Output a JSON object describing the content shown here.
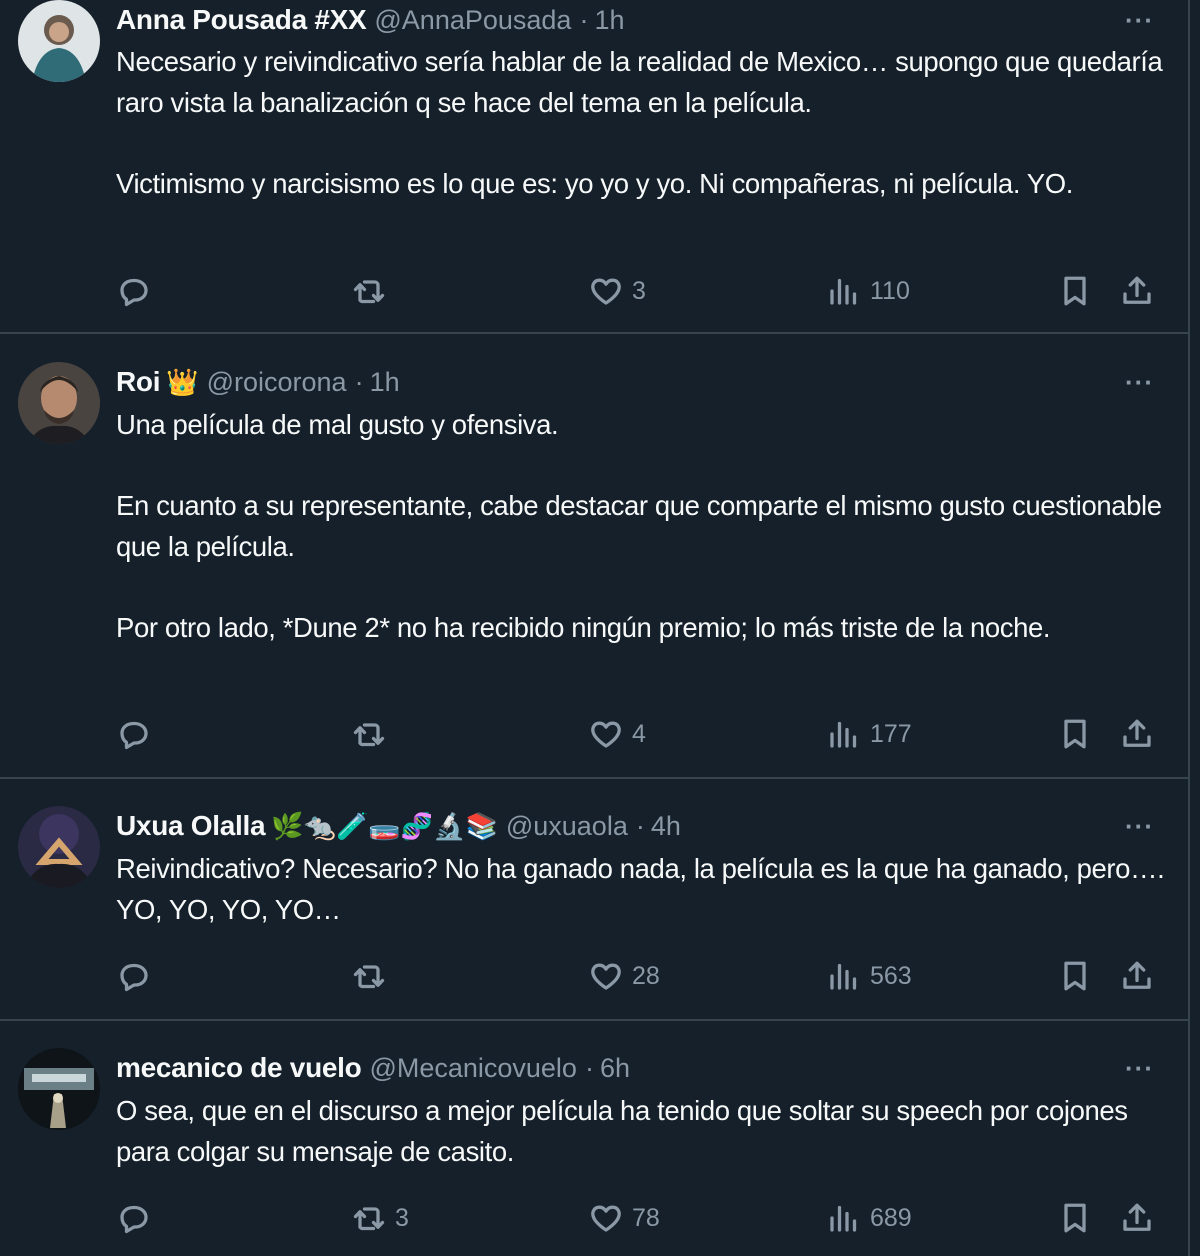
{
  "tweets": [
    {
      "name": "Anna Pousada #XX",
      "emoji": "",
      "handle": "@AnnaPousada",
      "time": "1h",
      "paragraphs": [
        "Necesario y reivindicativo sería hablar de la realidad de Mexico… supongo que quedaría raro vista la banalización q se hace del tema en la película.",
        "Victimismo y narcisismo es lo que es: yo yo y yo. Ni compañeras, ni película. YO."
      ],
      "replies": "",
      "retweets": "",
      "likes": "3",
      "views": "110"
    },
    {
      "name": "Roi",
      "emoji": "👑",
      "handle": "@roicorona",
      "time": "1h",
      "paragraphs": [
        "Una película de mal gusto y ofensiva.",
        "En cuanto a su representante, cabe destacar que comparte el mismo gusto cuestionable que la película.",
        "Por otro lado, *Dune 2* no ha recibido ningún premio; lo más triste de la noche."
      ],
      "replies": "",
      "retweets": "",
      "likes": "4",
      "views": "177"
    },
    {
      "name": "Uxua Olalla",
      "emoji": "🌿🐀🧪🧫🧬🔬📚",
      "handle": "@uxuaola",
      "time": "4h",
      "paragraphs": [
        "Reivindicativo? Necesario? No ha ganado nada, la película es la que ha ganado, pero…. YO, YO, YO, YO…"
      ],
      "replies": "",
      "retweets": "",
      "likes": "28",
      "views": "563"
    },
    {
      "name": "mecanico de vuelo",
      "emoji": "",
      "handle": "@Mecanicovuelo",
      "time": "6h",
      "paragraphs": [
        "O sea, que en el discurso a mejor película ha tenido que soltar su speech por cojones para colgar su mensaje de casito."
      ],
      "replies": "",
      "retweets": "3",
      "likes": "78",
      "views": "689"
    }
  ],
  "more_label": "···",
  "colors": {
    "background": "#15202b",
    "text": "#f7f9f9",
    "muted": "#8b98a5",
    "divider": "#38444d"
  },
  "icons": [
    "reply-icon",
    "retweet-icon",
    "like-icon",
    "views-icon",
    "bookmark-icon",
    "share-icon",
    "more-icon"
  ]
}
